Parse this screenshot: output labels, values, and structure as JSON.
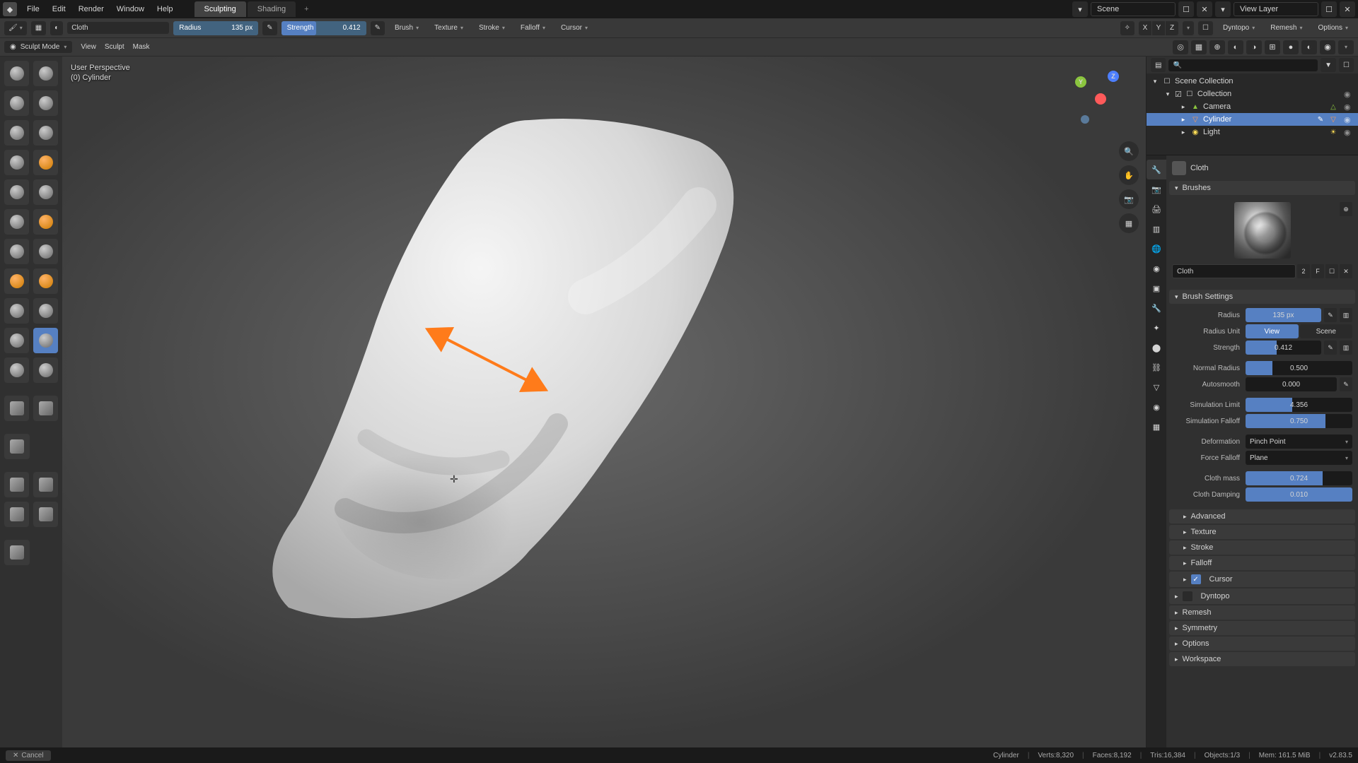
{
  "menubar": {
    "items": [
      "File",
      "Edit",
      "Render",
      "Window",
      "Help"
    ],
    "tabs": [
      "Sculpting",
      "Shading"
    ],
    "active_tab": 0,
    "scene_label": "Scene",
    "layer_label": "View Layer"
  },
  "tool_header": {
    "brush_name": "Cloth",
    "radius_label": "Radius",
    "radius_value": "135 px",
    "strength_label": "Strength",
    "strength_value": "0.412",
    "brush_dd": "Brush",
    "texture_dd": "Texture",
    "stroke_dd": "Stroke",
    "falloff_dd": "Falloff",
    "cursor_dd": "Cursor",
    "axes": [
      "X",
      "Y",
      "Z"
    ],
    "dyntopo": "Dyntopo",
    "remesh": "Remesh",
    "options": "Options"
  },
  "mode_header": {
    "mode": "Sculpt Mode",
    "menus": [
      "View",
      "Sculpt",
      "Mask"
    ]
  },
  "viewport": {
    "info_line1": "User Perspective",
    "info_line2": "(0) Cylinder"
  },
  "outliner": {
    "root": "Scene Collection",
    "collection": "Collection",
    "items": [
      {
        "name": "Camera",
        "type": "camera"
      },
      {
        "name": "Cylinder",
        "type": "mesh",
        "selected": true
      },
      {
        "name": "Light",
        "type": "light"
      }
    ]
  },
  "properties": {
    "brush_header": "Cloth",
    "brushes_panel": "Brushes",
    "brush_name": "Cloth",
    "brush_users": "2",
    "brush_settings": "Brush Settings",
    "radius_label": "Radius",
    "radius_value": "135 px",
    "radius_unit_label": "Radius Unit",
    "radius_unit_view": "View",
    "radius_unit_scene": "Scene",
    "strength_label": "Strength",
    "strength_value": "0.412",
    "normal_radius_label": "Normal Radius",
    "normal_radius_value": "0.500",
    "autosmooth_label": "Autosmooth",
    "autosmooth_value": "0.000",
    "sim_limit_label": "Simulation Limit",
    "sim_limit_value": "4.356",
    "sim_falloff_label": "Simulation Falloff",
    "sim_falloff_value": "0.750",
    "deformation_label": "Deformation",
    "deformation_value": "Pinch Point",
    "force_falloff_label": "Force Falloff",
    "force_falloff_value": "Plane",
    "cloth_mass_label": "Cloth mass",
    "cloth_mass_value": "0.724",
    "cloth_damping_label": "Cloth Damping",
    "cloth_damping_value": "0.010",
    "collapsed_panels": [
      "Advanced",
      "Texture",
      "Stroke",
      "Falloff",
      "Cursor",
      "Dyntopo",
      "Remesh",
      "Symmetry",
      "Options",
      "Workspace"
    ],
    "cursor_checked": true
  },
  "status": {
    "cancel": "Cancel",
    "object": "Cylinder",
    "verts": "Verts:8,320",
    "faces": "Faces:8,192",
    "tris": "Tris:16,384",
    "objects": "Objects:1/3",
    "mem": "Mem: 161.5 MiB",
    "version": "v2.83.5"
  },
  "colors": {
    "accent": "#5680c2",
    "arrow": "#ff7b1a"
  }
}
